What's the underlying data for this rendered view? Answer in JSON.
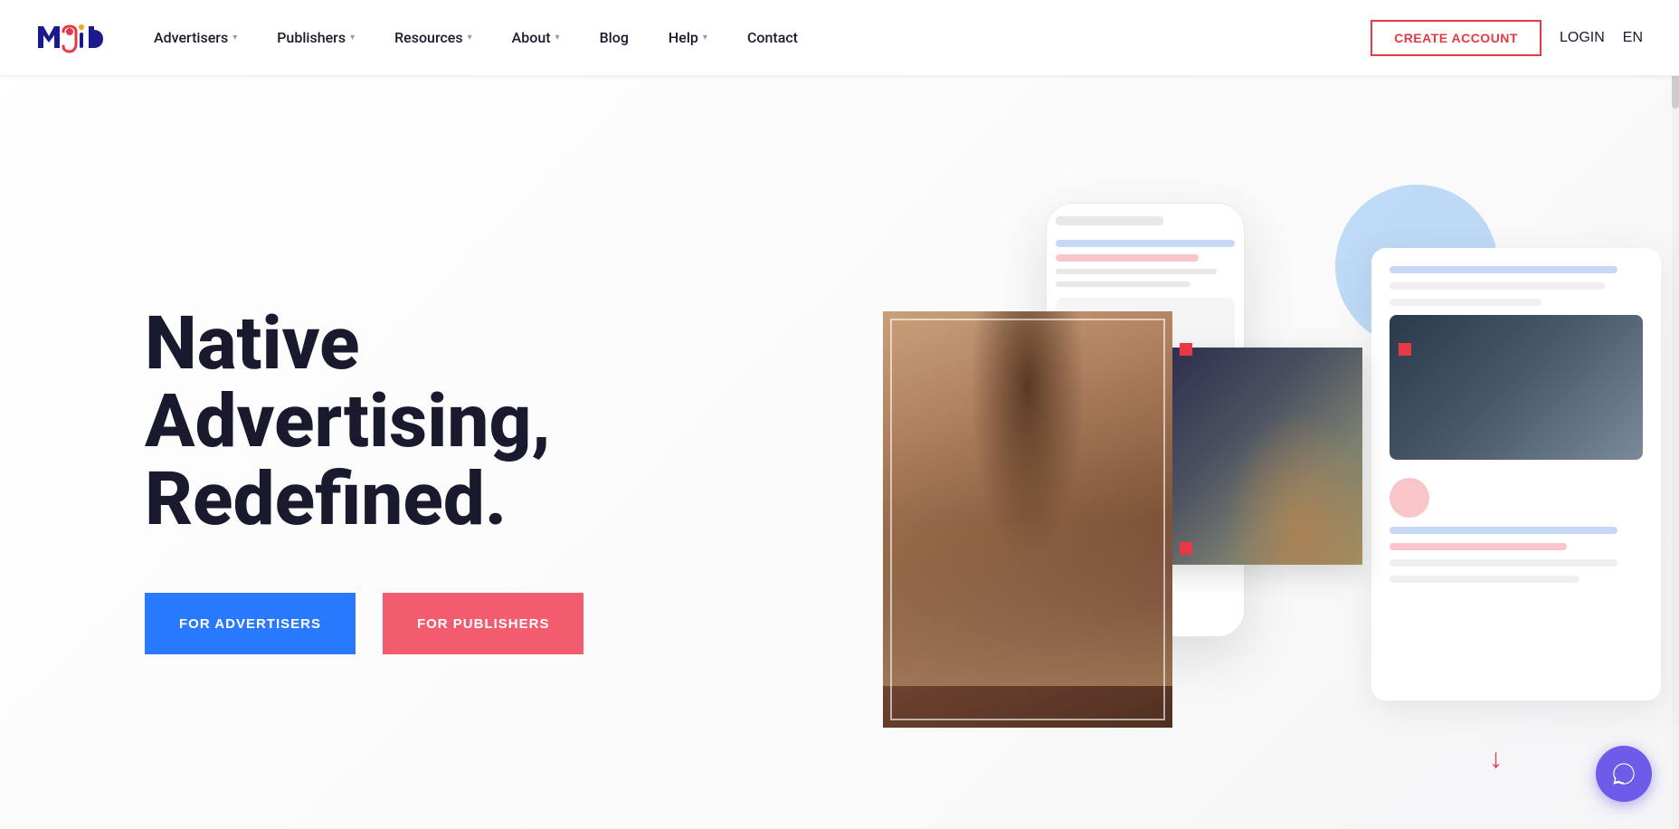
{
  "header": {
    "logo_text": "mgid",
    "nav_items": [
      {
        "label": "Advertisers",
        "has_dropdown": true
      },
      {
        "label": "Publishers",
        "has_dropdown": true
      },
      {
        "label": "Resources",
        "has_dropdown": true
      },
      {
        "label": "About",
        "has_dropdown": true
      },
      {
        "label": "Blog",
        "has_dropdown": false
      },
      {
        "label": "Help",
        "has_dropdown": true
      },
      {
        "label": "Contact",
        "has_dropdown": false
      }
    ],
    "create_account": "CREATE ACCOUNT",
    "login": "LOGIN",
    "lang": "EN"
  },
  "hero": {
    "title_line1": "Native",
    "title_line2": "Advertising,",
    "title_line3": "Redefined.",
    "btn_advertisers": "FOR ADVERTISERS",
    "btn_publishers": "FOR PUBLISHERS"
  }
}
